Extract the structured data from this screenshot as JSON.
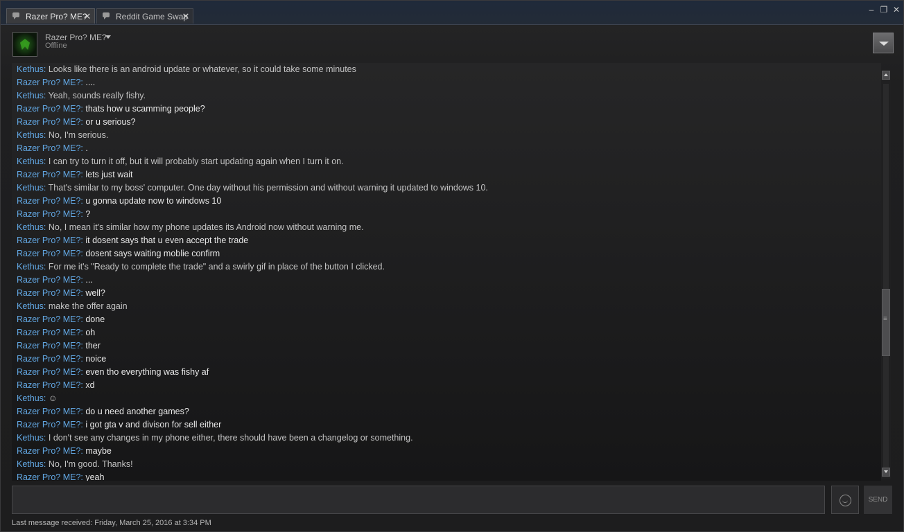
{
  "tabs": [
    {
      "label": "Razer Pro? ME?",
      "active": true
    },
    {
      "label": "Reddit Game Swap",
      "active": false
    }
  ],
  "window_controls": {
    "minimize": "–",
    "maximize": "❐",
    "close": "✕"
  },
  "contact": {
    "name": "Razer Pro? ME?",
    "status": "Offline"
  },
  "messages": [
    {
      "sender": "Kethus",
      "text": "Looks like there is an android update or whatever, so it could take some minutes"
    },
    {
      "sender": "Razer Pro? ME?",
      "text": "...."
    },
    {
      "sender": "Kethus",
      "text": "Yeah, sounds really fishy."
    },
    {
      "sender": "Razer Pro? ME?",
      "text": "thats how u scamming people?"
    },
    {
      "sender": "Razer Pro? ME?",
      "text": "or u serious?"
    },
    {
      "sender": "Kethus",
      "text": "No, I'm serious."
    },
    {
      "sender": "Razer Pro? ME?",
      "text": "."
    },
    {
      "sender": "Kethus",
      "text": "I can try to turn it off, but it will probably start updating again when I turn it on."
    },
    {
      "sender": "Razer Pro? ME?",
      "text": "lets just wait"
    },
    {
      "sender": "Kethus",
      "text": "That's similar to my boss' computer. One day without his permission and without warning it updated to windows 10."
    },
    {
      "sender": "Razer Pro? ME?",
      "text": "u gonna update now to windows 10"
    },
    {
      "sender": "Razer Pro? ME?",
      "text": "?"
    },
    {
      "sender": "Kethus",
      "text": "No, I mean it's similar how my phone updates its Android now without warning me."
    },
    {
      "sender": "Razer Pro? ME?",
      "text": "it dosent says that u even accept the trade"
    },
    {
      "sender": "Razer Pro? ME?",
      "text": "dosent says waiting moblie confirm"
    },
    {
      "sender": "Kethus",
      "text": "For me it's \"Ready to complete the trade\" and a swirly gif in place of the button I clicked."
    },
    {
      "sender": "Razer Pro? ME?",
      "text": "..."
    },
    {
      "sender": "Razer Pro? ME?",
      "text": "well?"
    },
    {
      "sender": "Kethus",
      "text": "make the offer again"
    },
    {
      "sender": "Razer Pro? ME?",
      "text": "done"
    },
    {
      "sender": "Razer Pro? ME?",
      "text": "oh"
    },
    {
      "sender": "Razer Pro? ME?",
      "text": "ther"
    },
    {
      "sender": "Razer Pro? ME?",
      "text": "noice"
    },
    {
      "sender": "Razer Pro? ME?",
      "text": "even tho everything was fishy af"
    },
    {
      "sender": "Razer Pro? ME?",
      "text": "xd"
    },
    {
      "sender": "Kethus",
      "text": "☺"
    },
    {
      "sender": "Razer Pro? ME?",
      "text": "do u need another games?"
    },
    {
      "sender": "Razer Pro? ME?",
      "text": "i got gta v and divison for sell either"
    },
    {
      "sender": "Kethus",
      "text": "I don't see any changes in my phone either, there should have been a changelog or something."
    },
    {
      "sender": "Razer Pro? ME?",
      "text": "maybe"
    },
    {
      "sender": "Kethus",
      "text": "No, I'm good. Thanks!"
    },
    {
      "sender": "Razer Pro? ME?",
      "text": "yeah"
    }
  ],
  "composer": {
    "value": "",
    "send_label": "SEND"
  },
  "footer": {
    "last_message": "Last message received: Friday, March 25, 2016 at 3:34 PM"
  },
  "colors": {
    "sender": "#62a7e3",
    "background": "#1e1e1f"
  }
}
